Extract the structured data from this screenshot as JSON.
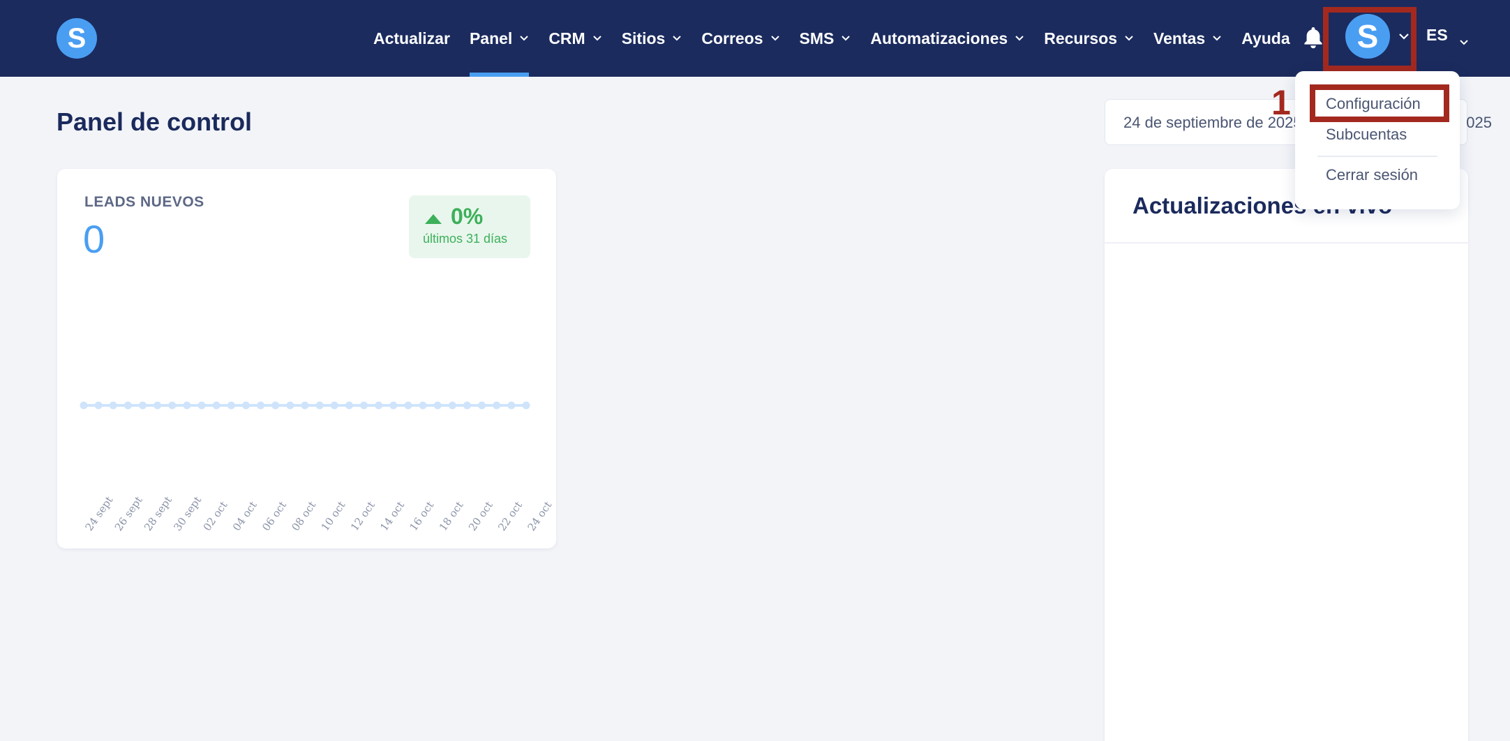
{
  "header": {
    "logo_letter": "S",
    "nav": [
      {
        "label": "Actualizar",
        "dropdown": false
      },
      {
        "label": "Panel",
        "dropdown": true,
        "active": true
      },
      {
        "label": "CRM",
        "dropdown": true
      },
      {
        "label": "Sitios",
        "dropdown": true
      },
      {
        "label": "Correos",
        "dropdown": true
      },
      {
        "label": "SMS",
        "dropdown": true
      },
      {
        "label": "Automatizaciones",
        "dropdown": true
      },
      {
        "label": "Recursos",
        "dropdown": true
      },
      {
        "label": "Ventas",
        "dropdown": true
      },
      {
        "label": "Ayuda",
        "dropdown": false
      }
    ],
    "avatar_letter": "S",
    "language": "ES"
  },
  "page": {
    "title": "Panel de control",
    "date_start": "24 de septiembre de 2025",
    "date_end": "025"
  },
  "leads_card": {
    "label": "LEADS NUEVOS",
    "value": "0",
    "change": "0%",
    "change_period": "últimos 31 días"
  },
  "chart_data": {
    "type": "line",
    "point_count": 31,
    "values": [
      0,
      0,
      0,
      0,
      0,
      0,
      0,
      0,
      0,
      0,
      0,
      0,
      0,
      0,
      0,
      0,
      0,
      0,
      0,
      0,
      0,
      0,
      0,
      0,
      0,
      0,
      0,
      0,
      0,
      0,
      0
    ],
    "tick_labels": [
      "24 sept",
      "26 sept",
      "28 sept",
      "30 sept",
      "02 oct",
      "04 oct",
      "06 oct",
      "08 oct",
      "10 oct",
      "12 oct",
      "14 oct",
      "16 oct",
      "18 oct",
      "20 oct",
      "22 oct",
      "24 oct"
    ],
    "color": "#cfe4fb"
  },
  "live_updates": {
    "title": "Actualizaciones en vivo"
  },
  "user_menu": {
    "items": [
      "Configuración",
      "Subcuentas",
      "Cerrar sesión"
    ]
  },
  "annotation": {
    "step": "1",
    "color": "#a3291f"
  }
}
